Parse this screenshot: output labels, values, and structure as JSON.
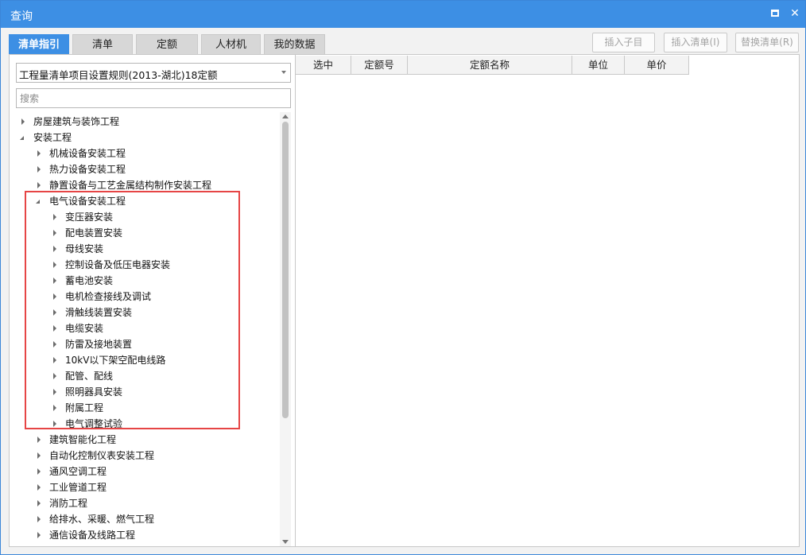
{
  "window": {
    "title": "查询"
  },
  "tabs": [
    {
      "label": "清单指引",
      "active": true
    },
    {
      "label": "清单",
      "active": false
    },
    {
      "label": "定额",
      "active": false
    },
    {
      "label": "人材机",
      "active": false
    },
    {
      "label": "我的数据",
      "active": false
    }
  ],
  "actions": {
    "insert_child": "插入子目",
    "insert_list": "插入清单(I)",
    "replace_list": "替换清单(R)"
  },
  "left": {
    "select_value": "工程量清单项目设置规则(2013-湖北)18定额",
    "search_placeholder": "搜索"
  },
  "tree": [
    {
      "label": "房屋建筑与装饰工程",
      "level": 0,
      "state": "collapsed"
    },
    {
      "label": "安装工程",
      "level": 0,
      "state": "expanded"
    },
    {
      "label": "机械设备安装工程",
      "level": 1,
      "state": "collapsed"
    },
    {
      "label": "热力设备安装工程",
      "level": 1,
      "state": "collapsed"
    },
    {
      "label": "静置设备与工艺金属结构制作安装工程",
      "level": 1,
      "state": "collapsed"
    },
    {
      "label": "电气设备安装工程",
      "level": 1,
      "state": "expanded"
    },
    {
      "label": "变压器安装",
      "level": 2,
      "state": "collapsed"
    },
    {
      "label": "配电装置安装",
      "level": 2,
      "state": "collapsed"
    },
    {
      "label": "母线安装",
      "level": 2,
      "state": "collapsed"
    },
    {
      "label": "控制设备及低压电器安装",
      "level": 2,
      "state": "collapsed"
    },
    {
      "label": "蓄电池安装",
      "level": 2,
      "state": "collapsed"
    },
    {
      "label": "电机检查接线及调试",
      "level": 2,
      "state": "collapsed"
    },
    {
      "label": "滑触线装置安装",
      "level": 2,
      "state": "collapsed"
    },
    {
      "label": "电缆安装",
      "level": 2,
      "state": "collapsed"
    },
    {
      "label": "防雷及接地装置",
      "level": 2,
      "state": "collapsed"
    },
    {
      "label": "10kV以下架空配电线路",
      "level": 2,
      "state": "collapsed"
    },
    {
      "label": "配管、配线",
      "level": 2,
      "state": "collapsed"
    },
    {
      "label": "照明器具安装",
      "level": 2,
      "state": "collapsed"
    },
    {
      "label": "附属工程",
      "level": 2,
      "state": "collapsed"
    },
    {
      "label": "电气调整试验",
      "level": 2,
      "state": "collapsed"
    },
    {
      "label": "建筑智能化工程",
      "level": 1,
      "state": "collapsed"
    },
    {
      "label": "自动化控制仪表安装工程",
      "level": 1,
      "state": "collapsed"
    },
    {
      "label": "通风空调工程",
      "level": 1,
      "state": "collapsed"
    },
    {
      "label": "工业管道工程",
      "level": 1,
      "state": "collapsed"
    },
    {
      "label": "消防工程",
      "level": 1,
      "state": "collapsed"
    },
    {
      "label": "给排水、采暖、燃气工程",
      "level": 1,
      "state": "collapsed"
    },
    {
      "label": "通信设备及线路工程",
      "level": 1,
      "state": "collapsed"
    }
  ],
  "grid": {
    "columns": [
      "选中",
      "定额号",
      "定额名称",
      "单位",
      "单价"
    ]
  },
  "colors": {
    "accent": "#3d8fe4",
    "highlight_border": "#e64545"
  }
}
